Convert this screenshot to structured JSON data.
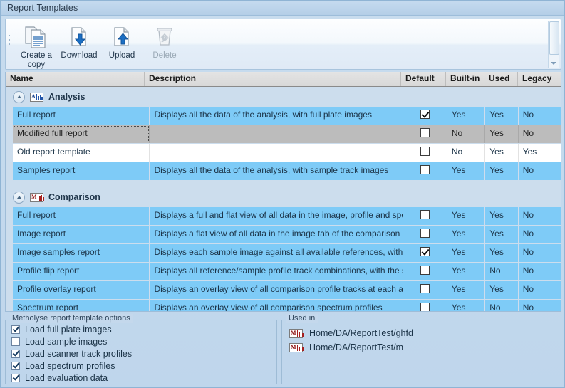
{
  "window": {
    "title": "Report Templates"
  },
  "toolbar": {
    "buttons": [
      {
        "label": "Create a copy",
        "icon": "copy-document-icon",
        "enabled": true
      },
      {
        "label": "Download",
        "icon": "download-document-icon",
        "enabled": true
      },
      {
        "label": "Upload",
        "icon": "upload-document-icon",
        "enabled": true
      },
      {
        "label": "Delete",
        "icon": "trash-icon",
        "enabled": false
      }
    ]
  },
  "grid": {
    "columns": [
      "Name",
      "Description",
      "Default",
      "Built-in",
      "Used",
      "Legacy"
    ],
    "groups": [
      {
        "title": "Analysis",
        "icon": "analysis-chart-icon",
        "icon_letter": "A",
        "icon_color": "#2255a8",
        "rows": [
          {
            "name": "Full report",
            "description": "Displays all the data of the analysis, with full plate images",
            "default": true,
            "builtin": "Yes",
            "used": "Yes",
            "legacy": "No",
            "state": "blue"
          },
          {
            "name": "Modified full report",
            "description": "",
            "default": false,
            "builtin": "No",
            "used": "Yes",
            "legacy": "No",
            "state": "selected"
          },
          {
            "name": "Old report template",
            "description": "",
            "default": false,
            "builtin": "No",
            "used": "Yes",
            "legacy": "Yes",
            "state": "white"
          },
          {
            "name": "Samples report",
            "description": "Displays all the data of the analysis, with sample track images",
            "default": false,
            "builtin": "Yes",
            "used": "Yes",
            "legacy": "No",
            "state": "blue"
          }
        ]
      },
      {
        "title": "Comparison",
        "icon": "comparison-chart-icon",
        "icon_letter": "M",
        "icon_color": "#a51f1f",
        "rows": [
          {
            "name": "Full report",
            "description": "Displays a full and flat view of all data in the image, profile and spe",
            "default": false,
            "builtin": "Yes",
            "used": "Yes",
            "legacy": "No",
            "state": "blue"
          },
          {
            "name": "Image report",
            "description": "Displays a flat view of all data in the image tab of the comparison",
            "default": false,
            "builtin": "Yes",
            "used": "Yes",
            "legacy": "No",
            "state": "blue"
          },
          {
            "name": "Image samples report",
            "description": "Displays each sample image against all available references, with a",
            "default": true,
            "builtin": "Yes",
            "used": "Yes",
            "legacy": "No",
            "state": "blue"
          },
          {
            "name": "Profile flip report",
            "description": "Displays all reference/sample profile track combinations, with the s",
            "default": false,
            "builtin": "Yes",
            "used": "No",
            "legacy": "No",
            "state": "blue"
          },
          {
            "name": "Profile overlay report",
            "description": "Displays an overlay view of all comparison profile tracks at each av",
            "default": false,
            "builtin": "Yes",
            "used": "Yes",
            "legacy": "No",
            "state": "blue"
          },
          {
            "name": "Spectrum report",
            "description": "Displays an overlay view of all comparison spectrum profiles",
            "default": false,
            "builtin": "Yes",
            "used": "No",
            "legacy": "No",
            "state": "blue"
          }
        ]
      }
    ]
  },
  "options_panel": {
    "title": "Metholyse report template options",
    "items": [
      {
        "label": "Load full plate images",
        "checked": true
      },
      {
        "label": "Load sample images",
        "checked": false
      },
      {
        "label": "Load scanner track profiles",
        "checked": true
      },
      {
        "label": "Load spectrum profiles",
        "checked": true
      },
      {
        "label": "Load evaluation data",
        "checked": true
      }
    ]
  },
  "used_in_panel": {
    "title": "Used in",
    "items": [
      {
        "label": "Home/DA/ReportTest/ghfd",
        "icon": "comparison-chart-icon"
      },
      {
        "label": "Home/DA/ReportTest/m",
        "icon": "comparison-chart-icon"
      }
    ]
  }
}
